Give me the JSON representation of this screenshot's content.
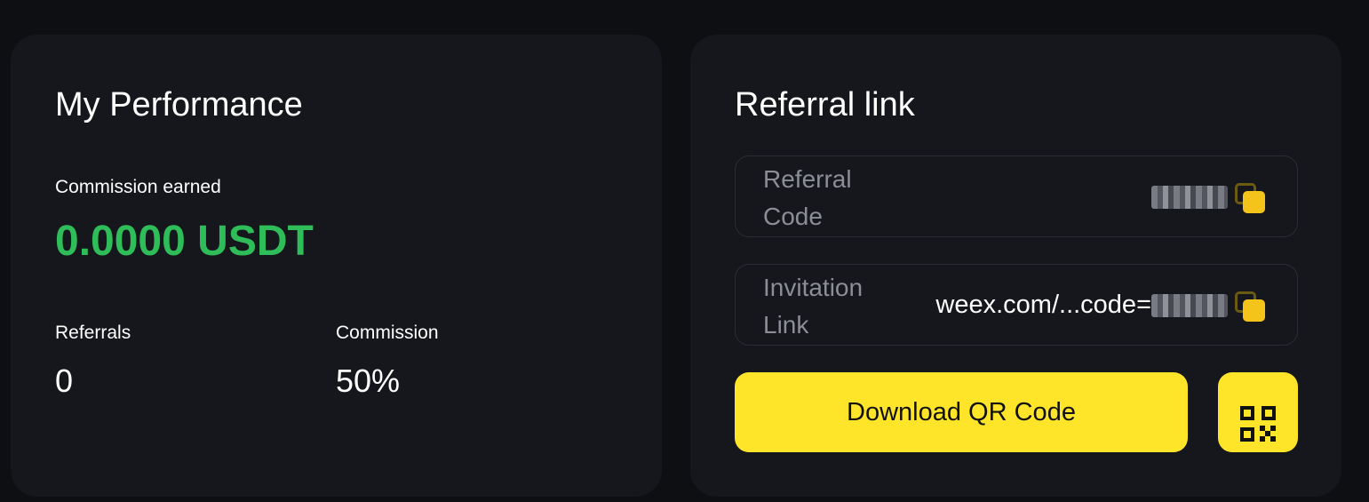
{
  "performance": {
    "title": "My Performance",
    "commission_earned_label": "Commission earned",
    "commission_earned_value": "0.0000 USDT",
    "referrals_label": "Referrals",
    "referrals_value": "0",
    "commission_label": "Commission",
    "commission_value": "50%"
  },
  "referral": {
    "title": "Referral link",
    "code_label": "Referral Code",
    "link_label": "Invitation Link",
    "link_value_prefix": "weex.com/...code=",
    "download_button_label": "Download QR Code"
  },
  "colors": {
    "background": "#0e0f12",
    "card": "#16171c",
    "accent_yellow": "#ffe52a",
    "positive_green": "#2ebd59",
    "muted_text": "#8b8d97"
  },
  "icons": {
    "copy": "copy-icon",
    "qr": "qr-code-icon"
  }
}
